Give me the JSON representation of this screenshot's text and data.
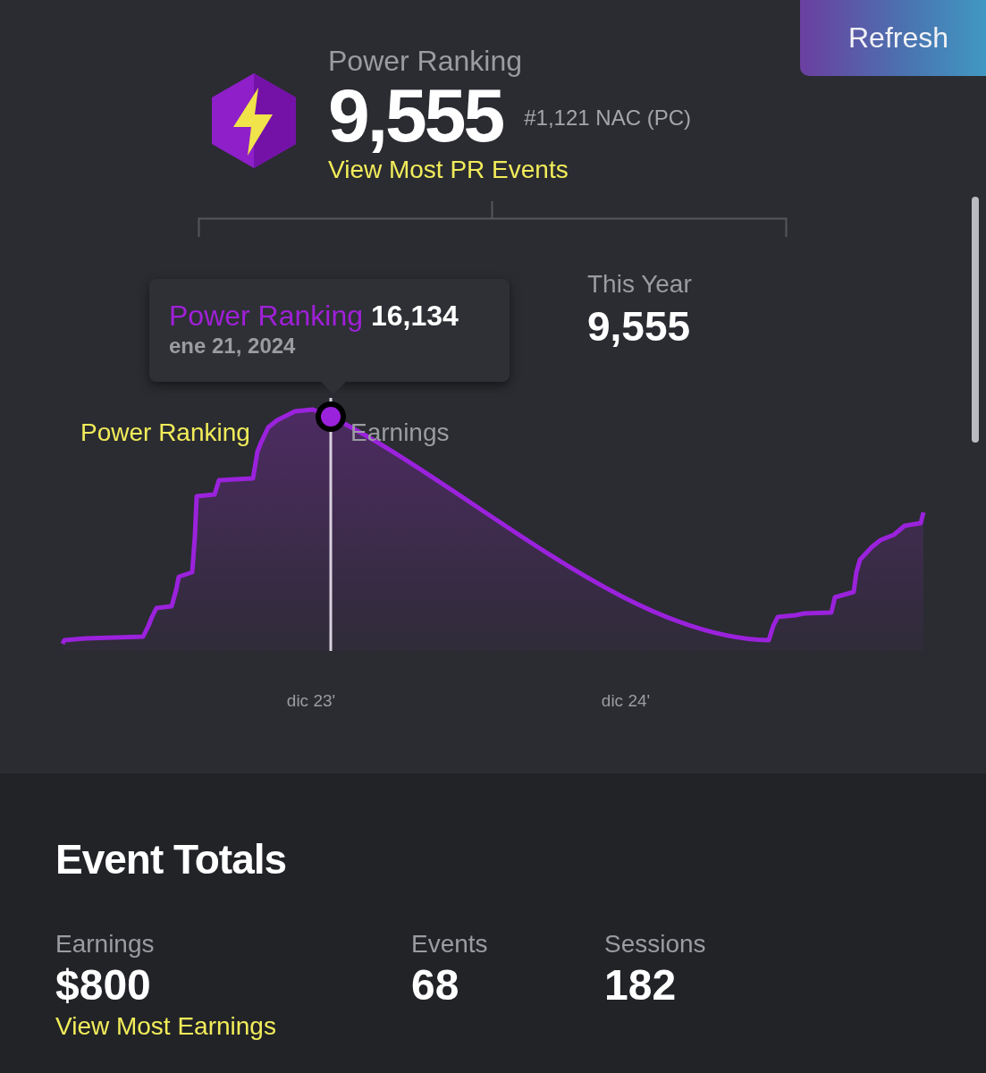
{
  "refresh_button": "Refresh",
  "power_ranking": {
    "label": "Power Ranking",
    "value": "9,555",
    "rank": "#1,121 NAC (PC)",
    "link": "View Most PR Events"
  },
  "periods": [
    {
      "label": "This Year",
      "value": "9,555"
    }
  ],
  "chart": {
    "legend": [
      {
        "label": "Power Ranking",
        "selected": true
      },
      {
        "label": "Earnings",
        "selected": false
      }
    ],
    "x_labels": [
      "dic 23'",
      "dic 24'"
    ],
    "tooltip": {
      "series": "Power Ranking",
      "value": "16,134",
      "date": "ene 21, 2024"
    }
  },
  "event_totals": {
    "title": "Event Totals",
    "stats": [
      {
        "label": "Earnings",
        "value": "$800",
        "link": "View Most Earnings"
      },
      {
        "label": "Events",
        "value": "68"
      },
      {
        "label": "Sessions",
        "value": "182"
      }
    ]
  }
}
